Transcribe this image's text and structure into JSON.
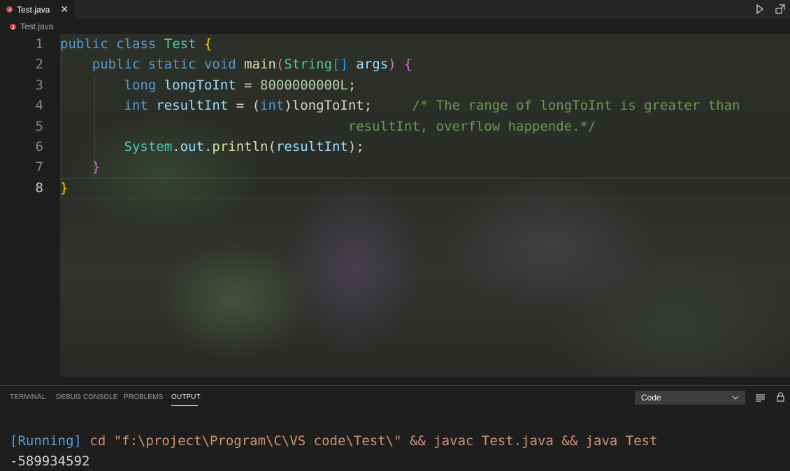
{
  "tabs": [
    {
      "label": "Test.java",
      "close": "✕",
      "active": true
    }
  ],
  "breadcrumb": {
    "file": "Test.java"
  },
  "editor": {
    "line_numbers": [
      "1",
      "2",
      "3",
      "4",
      "5",
      "6",
      "7",
      "8"
    ],
    "active_line": "8",
    "code": {
      "l1": {
        "t1": "public",
        "t2": " ",
        "t3": "class",
        "t4": " ",
        "t5": "Test",
        "t6": " ",
        "t7": "{"
      },
      "l2": {
        "t0": "    ",
        "t1": "public",
        "t2": " ",
        "t3": "static",
        "t4": " ",
        "t5": "void",
        "t6": " ",
        "t7": "main",
        "t8": "(",
        "t9": "String",
        "t10": "[]",
        "t11": " ",
        "t12": "args",
        "t13": ")",
        "t14": " ",
        "t15": "{"
      },
      "l3": {
        "t0": "        ",
        "t1": "long",
        "t2": " ",
        "t3": "longToInt",
        "t4": " = ",
        "t5": "8000000000L",
        "t6": ";"
      },
      "l4": {
        "t0": "        ",
        "t1": "int",
        "t2": " ",
        "t3": "resultInt",
        "t4": " = (",
        "t5": "int",
        "t6": ")longToInt;",
        "t7": "     ",
        "t8": "/* The range of longToInt is greater than"
      },
      "l5": {
        "t0": "                                ",
        "t1": "    resultInt, overflow happende.*/"
      },
      "l6": {
        "t0": "        ",
        "t1": "System",
        "t2": ".",
        "t3": "out",
        "t4": ".",
        "t5": "println",
        "t6": "(",
        "t7": "resultInt",
        "t8": ");"
      },
      "l7": {
        "t0": "    ",
        "t1": "}"
      },
      "l8": {
        "t1": "}"
      }
    }
  },
  "panel": {
    "tabs": [
      "TERMINAL",
      "DEBUG CONSOLE",
      "PROBLEMS",
      "OUTPUT"
    ],
    "active_tab": "OUTPUT",
    "output_channel": "Code",
    "output": {
      "running": "[Running]",
      "command": " cd \"f:\\project\\Program\\C\\VS code\\Test\\\" && javac Test.java && java Test",
      "result": "-589934592"
    }
  },
  "icons": {
    "run": "play-icon",
    "split": "split-editor-icon",
    "file": "java-file-icon",
    "list": "list-filter-icon",
    "lock": "lock-icon",
    "chevron": "chevron-down-icon"
  },
  "colors": {
    "keyword": "#569cd6",
    "type": "#4ec9b0",
    "function": "#dcdcaa",
    "variable": "#9cdcfe",
    "number": "#b5cea8",
    "comment": "#6a9955",
    "string_output": "#ce9178",
    "java_icon": "#c74a4a"
  }
}
